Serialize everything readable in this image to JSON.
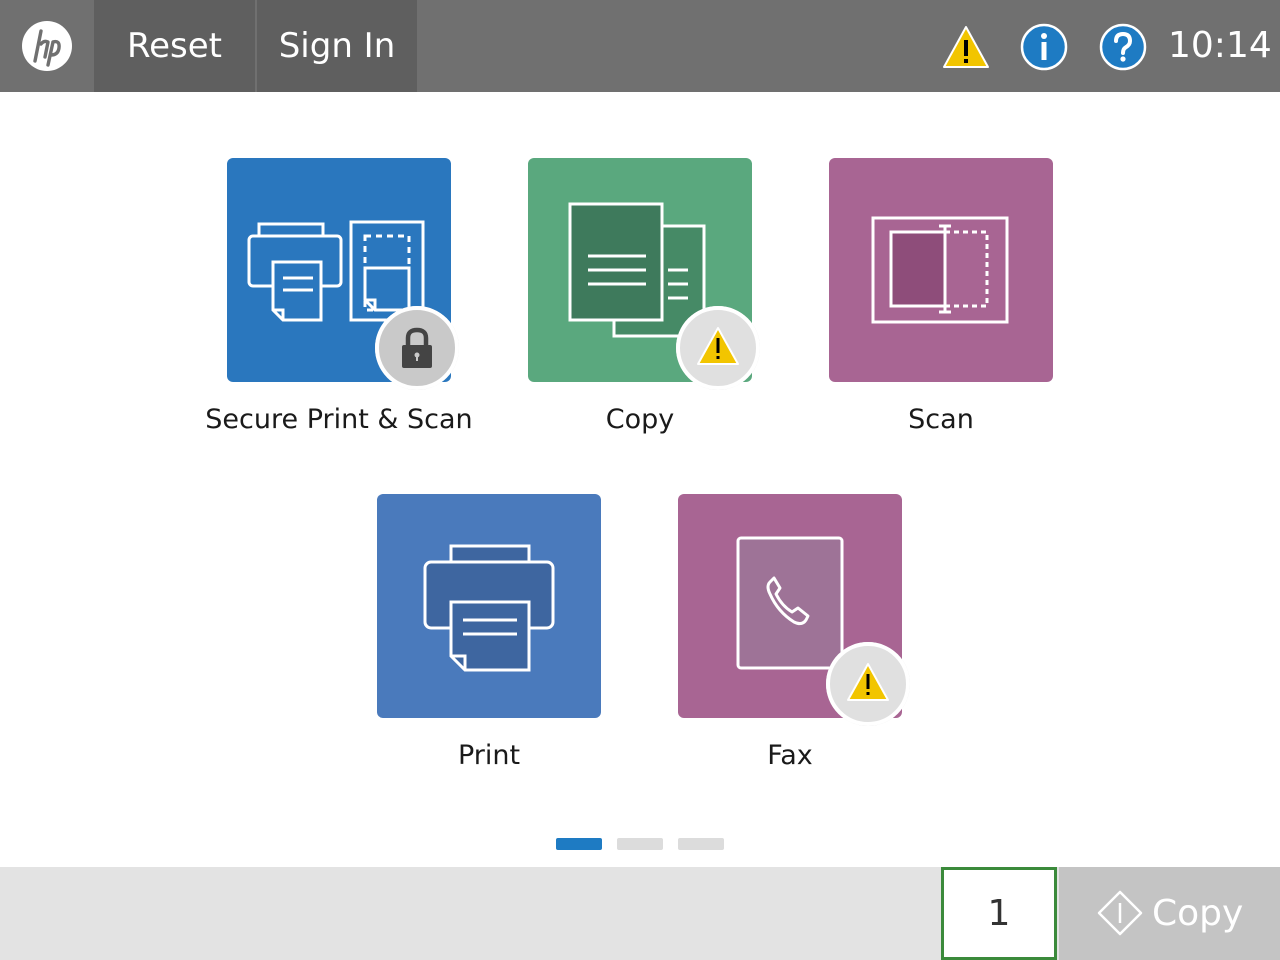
{
  "header": {
    "reset_label": "Reset",
    "signin_label": "Sign In",
    "clock": "10:14",
    "icons": [
      "hp-logo-icon",
      "warning-icon",
      "info-icon",
      "help-icon"
    ]
  },
  "apps": [
    {
      "label": "Secure Print & Scan",
      "color": "#2a77be",
      "badge": "lock-icon"
    },
    {
      "label": "Copy",
      "color": "#5aa87e",
      "badge": "warning-icon"
    },
    {
      "label": "Scan",
      "color": "#a86593",
      "badge": null
    },
    {
      "label": "Print",
      "color": "#4a7abc",
      "badge": null
    },
    {
      "label": "Fax",
      "color": "#a86593",
      "badge": "warning-icon"
    }
  ],
  "pager": {
    "pages": 3,
    "current": 1
  },
  "footer": {
    "copies_value": "1",
    "start_label": "Copy"
  },
  "colors": {
    "topbar": "#707070",
    "topbar_button": "#5f5f5f",
    "warning": "#f2c500",
    "info": "#1e7bc3",
    "pager_active": "#1e7bc3",
    "copies_border": "#3b8a3b"
  }
}
